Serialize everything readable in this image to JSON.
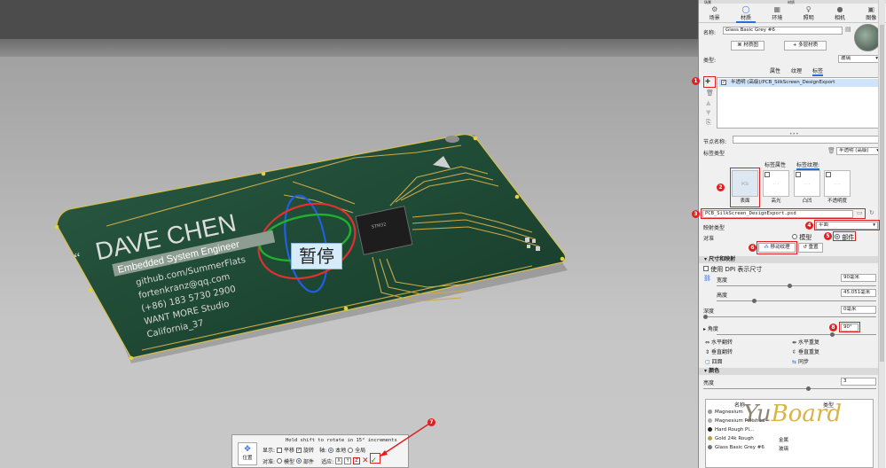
{
  "panel": {
    "top_left": "场景",
    "top_center": "材质",
    "tabs": [
      {
        "label": "场景",
        "icon": "scene-icon"
      },
      {
        "label": "材质",
        "icon": "material-icon"
      },
      {
        "label": "环境",
        "icon": "environment-icon"
      },
      {
        "label": "照明",
        "icon": "lighting-icon"
      },
      {
        "label": "相机",
        "icon": "camera-icon"
      },
      {
        "label": "图像",
        "icon": "image-icon"
      }
    ],
    "name_label": "名称:",
    "name_value": "Glass Basic Grey #6",
    "material_graph_btn": "材质图",
    "multi_layer_btn": "多层材质",
    "type_label": "类型:",
    "type_value": "玻璃",
    "sub_tabs": [
      "属性",
      "纹理",
      "标签"
    ],
    "decal_row": "半透明 (高级)/PCB_SilkScreen_DesignExport",
    "node_name_label": "节点名称:",
    "label_type_label": "标签类型",
    "label_type_value": "半透明 (高级)",
    "label_tabs": [
      "标签属性",
      "标签纹理:"
    ],
    "thumbs": [
      "表面",
      "高光",
      "凸凹",
      "不透明度"
    ],
    "file_name": "PCB_SilkScreen_DesignExport.psd",
    "mapping_label": "映射类型",
    "mapping_value": "平面",
    "target_label": "对准",
    "target_model": "模型",
    "target_part": "部件",
    "move_texture_btn": "移动纹理",
    "reset_btn": "重置",
    "size_section": "尺寸和映射",
    "use_dpi": "使用 DPI 表示尺寸",
    "width_label": "宽度",
    "width_value": "90毫米",
    "height_label": "高度",
    "height_value": "45.051毫米",
    "depth_label": "深度",
    "depth_value": "0毫米",
    "angle_label": "角度",
    "angle_value": "90°",
    "flip_h": "水平翻转",
    "repeat_h": "水平重复",
    "flip_v": "垂直翻转",
    "repeat_v": "垂直重复",
    "four_sides": "四面",
    "sync": "同步",
    "color_section": "颜色",
    "brightness_label": "亮度",
    "brightness_value": "3",
    "mat_list_headers": [
      "名称",
      "类型"
    ],
    "materials": [
      {
        "name": "Magnesium",
        "type": ""
      },
      {
        "name": "Magnesium Polished",
        "type": ""
      },
      {
        "name": "Hard Rough Pl...",
        "type": ""
      },
      {
        "name": "Gold 24k Rough",
        "type": "金属"
      },
      {
        "name": "Glass Basic Grey #6",
        "type": "玻璃"
      }
    ],
    "badges": [
      "1",
      "2",
      "3",
      "4",
      "5",
      "6",
      "7",
      "8"
    ]
  },
  "gizmo": {
    "hint": "Hold shift to rotate in 15° increments",
    "position_btn": "位置",
    "display_label": "显示:",
    "translate": "平移",
    "rotate": "旋转",
    "axis_label": "轴:",
    "local": "本地",
    "global": "全局",
    "target_label": "对准:",
    "model": "模型",
    "part": "部件",
    "snap_label": "适应:",
    "axes": [
      "X",
      "Y",
      "Z"
    ]
  },
  "viewport": {
    "pause_text": "暂停",
    "card": {
      "name": "DAVE CHEN",
      "title": "Embedded System Engineer",
      "lines": [
        "github.com/SummerFlats",
        "fortenkranz@qq.com",
        "(+86) 183 5730 2900",
        "WANT MORE Studio",
        "California_37"
      ],
      "quote_mark": "“"
    }
  },
  "watermark": {
    "part1": "Yu",
    "part2": "Board"
  },
  "colors": {
    "accent": "#2a6dd8",
    "annotation": "#e02020",
    "pcb": "#1f4a35"
  }
}
